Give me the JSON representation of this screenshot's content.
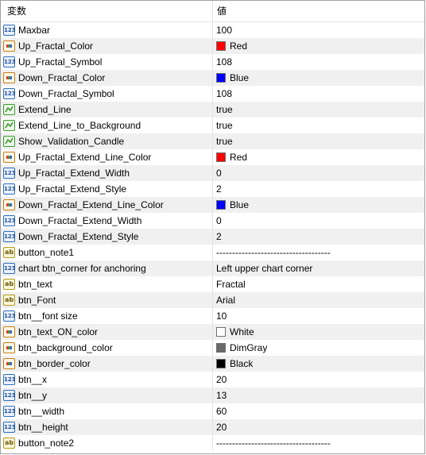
{
  "header": {
    "col_name": "変数",
    "col_value": "値"
  },
  "rows": [
    {
      "name": "Maxbar",
      "value": "100",
      "type": "int",
      "swatch": ""
    },
    {
      "name": "Up_Fractal_Color",
      "value": "Red",
      "type": "color",
      "swatch": "#ff0000"
    },
    {
      "name": "Up_Fractal_Symbol",
      "value": "108",
      "type": "int",
      "swatch": ""
    },
    {
      "name": "Down_Fractal_Color",
      "value": "Blue",
      "type": "color",
      "swatch": "#0000ff"
    },
    {
      "name": "Down_Fractal_Symbol",
      "value": "108",
      "type": "int",
      "swatch": ""
    },
    {
      "name": "Extend_Line",
      "value": "true",
      "type": "bool",
      "swatch": ""
    },
    {
      "name": "Extend_Line_to_Background",
      "value": "true",
      "type": "bool",
      "swatch": ""
    },
    {
      "name": "Show_Validation_Candle",
      "value": "true",
      "type": "bool",
      "swatch": ""
    },
    {
      "name": "Up_Fractal_Extend_Line_Color",
      "value": "Red",
      "type": "color",
      "swatch": "#ff0000"
    },
    {
      "name": "Up_Fractal_Extend_Width",
      "value": "0",
      "type": "int",
      "swatch": ""
    },
    {
      "name": "Up_Fractal_Extend_Style",
      "value": "2",
      "type": "int",
      "swatch": ""
    },
    {
      "name": "Down_Fractal_Extend_Line_Color",
      "value": "Blue",
      "type": "color",
      "swatch": "#0000ff"
    },
    {
      "name": "Down_Fractal_Extend_Width",
      "value": "0",
      "type": "int",
      "swatch": ""
    },
    {
      "name": "Down_Fractal_Extend_Style",
      "value": "2",
      "type": "int",
      "swatch": ""
    },
    {
      "name": "button_note1",
      "value": "------------------------------------",
      "type": "string",
      "swatch": ""
    },
    {
      "name": "chart btn_corner for anchoring",
      "value": "Left upper chart corner",
      "type": "int",
      "swatch": ""
    },
    {
      "name": "btn_text",
      "value": "Fractal",
      "type": "string",
      "swatch": ""
    },
    {
      "name": "btn_Font",
      "value": "Arial",
      "type": "string",
      "swatch": ""
    },
    {
      "name": "btn__font size",
      "value": "10",
      "type": "int",
      "swatch": ""
    },
    {
      "name": "btn_text_ON_color",
      "value": "White",
      "type": "color",
      "swatch": "#ffffff"
    },
    {
      "name": "btn_background_color",
      "value": "DimGray",
      "type": "color",
      "swatch": "#696969"
    },
    {
      "name": "btn_border_color",
      "value": "Black",
      "type": "color",
      "swatch": "#000000"
    },
    {
      "name": "btn__x",
      "value": "20",
      "type": "int",
      "swatch": ""
    },
    {
      "name": "btn__y",
      "value": "13",
      "type": "int",
      "swatch": ""
    },
    {
      "name": "btn__width",
      "value": "60",
      "type": "int",
      "swatch": ""
    },
    {
      "name": "btn__height",
      "value": "20",
      "type": "int",
      "swatch": ""
    },
    {
      "name": "button_note2",
      "value": "------------------------------------",
      "type": "string",
      "swatch": ""
    }
  ],
  "icon_labels": {
    "int": "123",
    "string": "ab"
  }
}
